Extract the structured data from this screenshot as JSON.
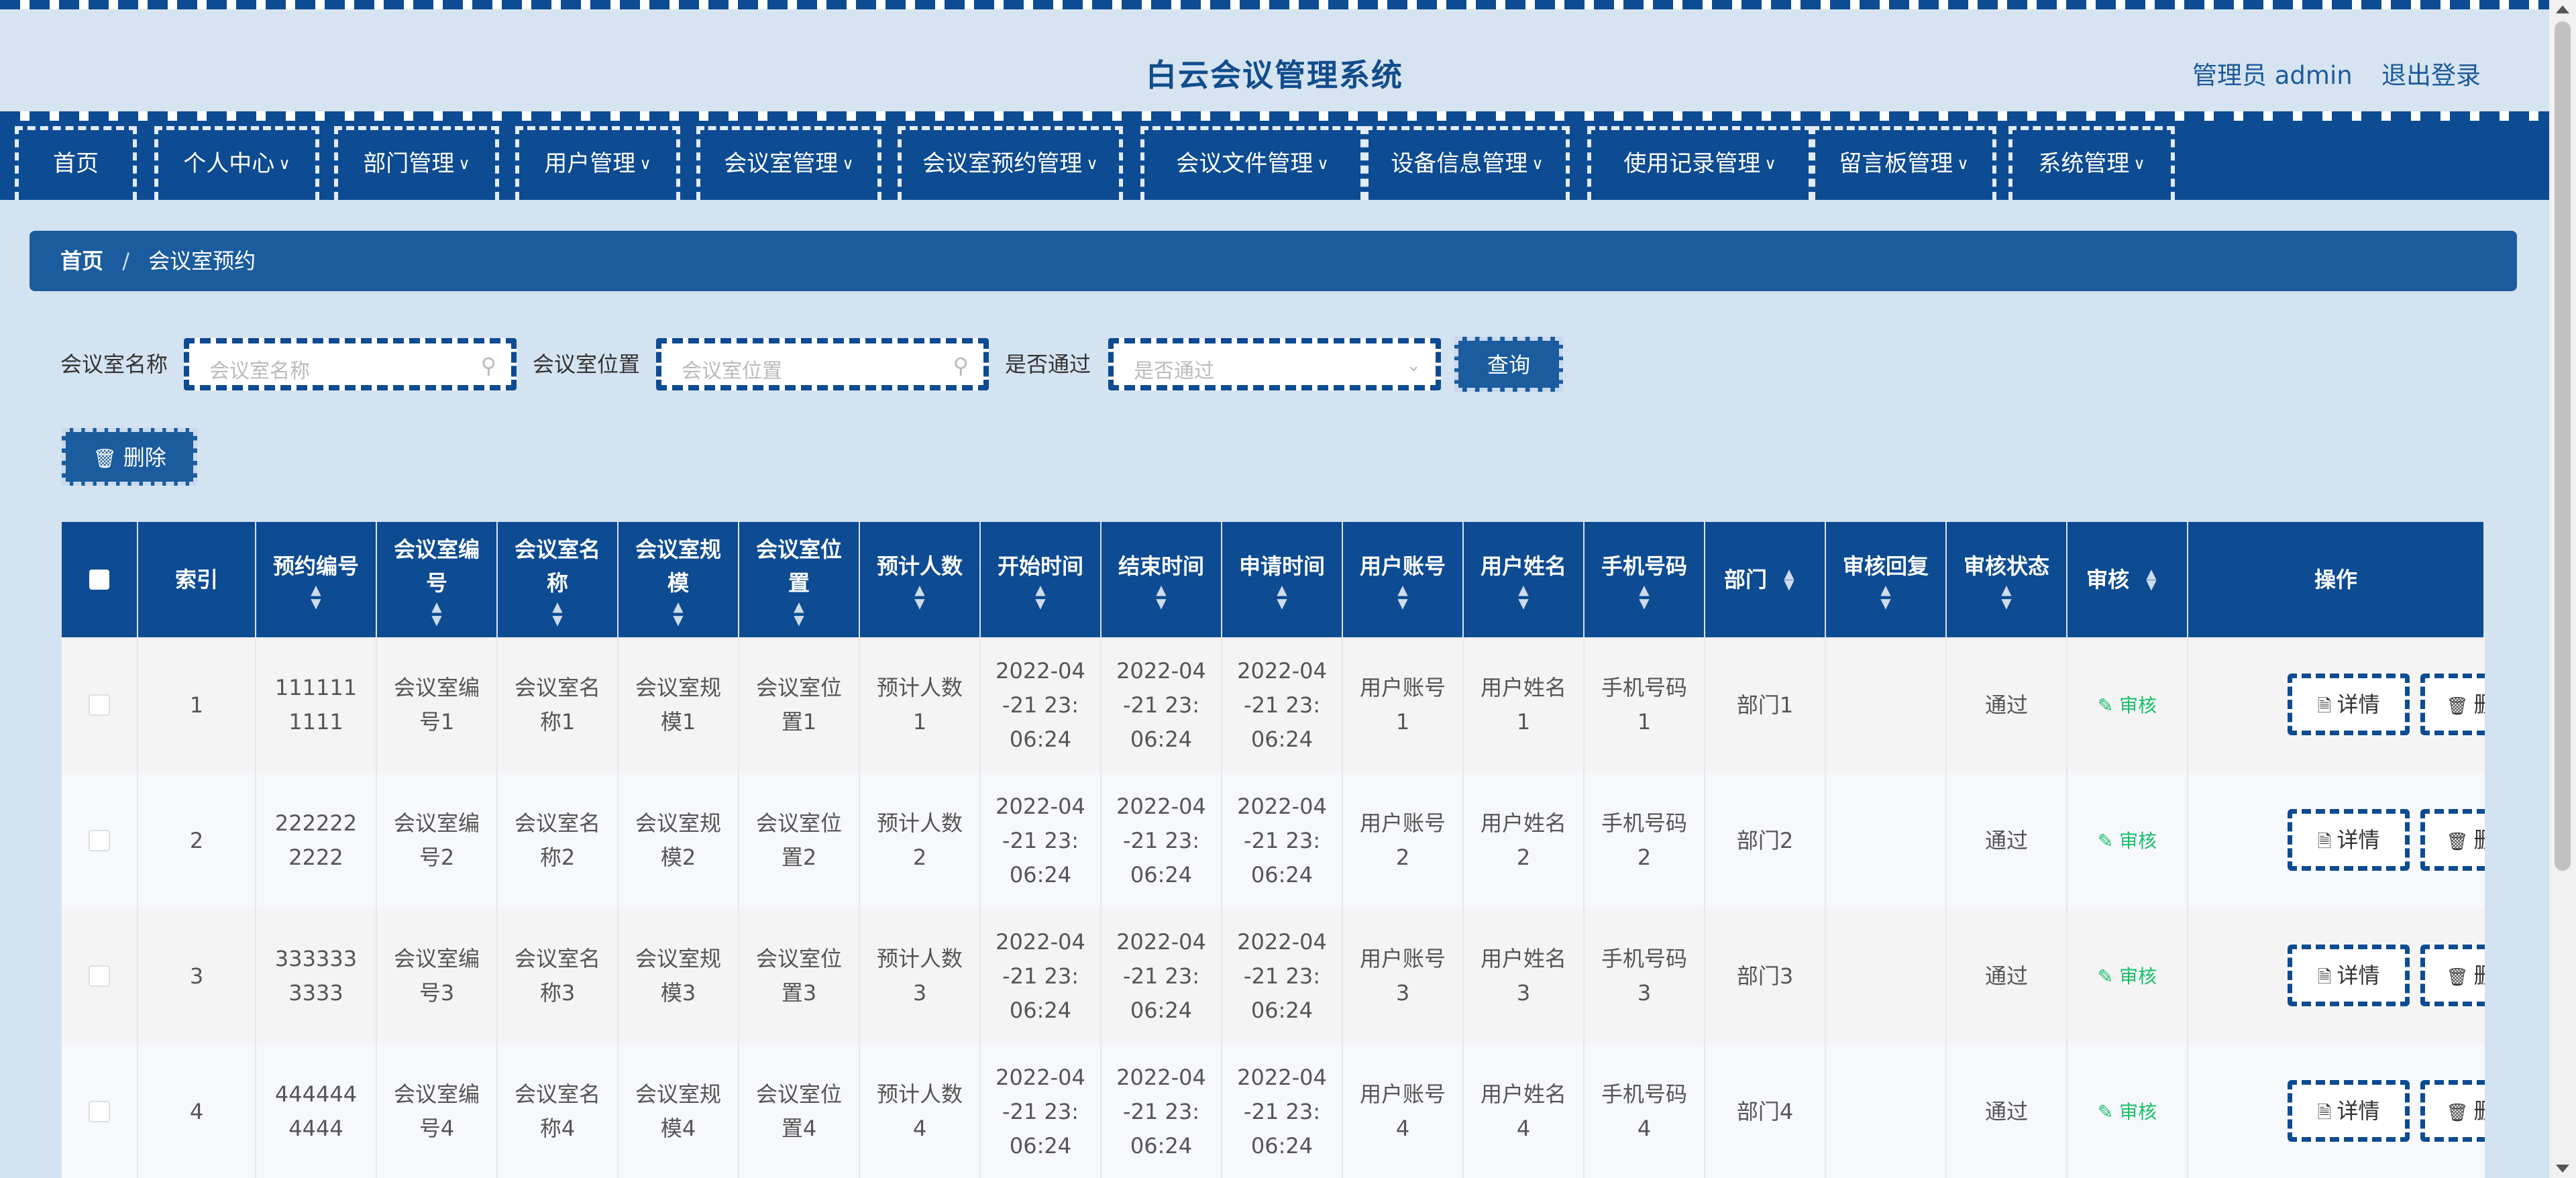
{
  "header": {
    "title": "白云会议管理系统",
    "user": "管理员 admin",
    "logout": "退出登录"
  },
  "nav": [
    {
      "label": "首页",
      "dropdown": false
    },
    {
      "label": "个人中心",
      "dropdown": true
    },
    {
      "label": "部门管理",
      "dropdown": true
    },
    {
      "label": "用户管理",
      "dropdown": true
    },
    {
      "label": "会议室管理",
      "dropdown": true
    },
    {
      "label": "会议室预约管理",
      "dropdown": true
    },
    {
      "label": "会议文件管理",
      "dropdown": true
    },
    {
      "label": "设备信息管理",
      "dropdown": true
    },
    {
      "label": "使用记录管理",
      "dropdown": true
    },
    {
      "label": "留言板管理",
      "dropdown": true
    },
    {
      "label": "系统管理",
      "dropdown": true
    }
  ],
  "breadcrumb": {
    "home": "首页",
    "separator": "/",
    "current": "会议室预约"
  },
  "search": {
    "room_name_label": "会议室名称",
    "room_name_placeholder": "会议室名称",
    "room_location_label": "会议室位置",
    "room_location_placeholder": "会议室位置",
    "approved_label": "是否通过",
    "approved_placeholder": "是否通过",
    "query_button": "查询"
  },
  "toolbar": {
    "delete_button": "删除"
  },
  "table": {
    "headers": [
      "索引",
      "预约编号",
      "会议室编号",
      "会议室名称",
      "会议室规模",
      "会议室位置",
      "预计人数",
      "开始时间",
      "结束时间",
      "申请时间",
      "用户账号",
      "用户姓名",
      "手机号码",
      "部门",
      "审核回复",
      "审核状态",
      "审核",
      "操作"
    ],
    "rows": [
      {
        "index": "1",
        "booking_no": "1111111111",
        "room_no": "会议室编号1",
        "room_name": "会议室名称1",
        "room_scale": "会议室规模1",
        "room_location": "会议室位置1",
        "expected": "预计人数1",
        "start": "2022-04-21 23:06:24",
        "end": "2022-04-21 23:06:24",
        "apply": "2022-04-21 23:06:24",
        "account": "用户账号1",
        "user_name": "用户姓名1",
        "phone": "手机号码1",
        "dept": "部门1",
        "reply": "",
        "status": "通过",
        "audit": "审核",
        "detail": "详情",
        "delete": "删除"
      },
      {
        "index": "2",
        "booking_no": "2222222222",
        "room_no": "会议室编号2",
        "room_name": "会议室名称2",
        "room_scale": "会议室规模2",
        "room_location": "会议室位置2",
        "expected": "预计人数2",
        "start": "2022-04-21 23:06:24",
        "end": "2022-04-21 23:06:24",
        "apply": "2022-04-21 23:06:24",
        "account": "用户账号2",
        "user_name": "用户姓名2",
        "phone": "手机号码2",
        "dept": "部门2",
        "reply": "",
        "status": "通过",
        "audit": "审核",
        "detail": "详情",
        "delete": "删除"
      },
      {
        "index": "3",
        "booking_no": "3333333333",
        "room_no": "会议室编号3",
        "room_name": "会议室名称3",
        "room_scale": "会议室规模3",
        "room_location": "会议室位置3",
        "expected": "预计人数3",
        "start": "2022-04-21 23:06:24",
        "end": "2022-04-21 23:06:24",
        "apply": "2022-04-21 23:06:24",
        "account": "用户账号3",
        "user_name": "用户姓名3",
        "phone": "手机号码3",
        "dept": "部门3",
        "reply": "",
        "status": "通过",
        "audit": "审核",
        "detail": "详情",
        "delete": "删除"
      },
      {
        "index": "4",
        "booking_no": "4444444444",
        "room_no": "会议室编号4",
        "room_name": "会议室名称4",
        "room_scale": "会议室规模4",
        "room_location": "会议室位置4",
        "expected": "预计人数4",
        "start": "2022-04-21 23:06:24",
        "end": "2022-04-21 23:06:24",
        "apply": "2022-04-21 23:06:24",
        "account": "用户账号4",
        "user_name": "用户姓名4",
        "phone": "手机号码4",
        "dept": "部门4",
        "reply": "",
        "status": "通过",
        "audit": "审核",
        "detail": "详情",
        "delete": "删除"
      }
    ]
  },
  "colors": {
    "primary": "#0d4b92",
    "accent": "#1b5c9e",
    "page_bg": "#d4e3f1",
    "audit_green": "#19be6b"
  },
  "icons": {
    "search": "search-icon",
    "dropdown": "chevron-down-icon",
    "trash": "trash-icon",
    "detail": "document-icon",
    "edit": "edit-icon"
  }
}
